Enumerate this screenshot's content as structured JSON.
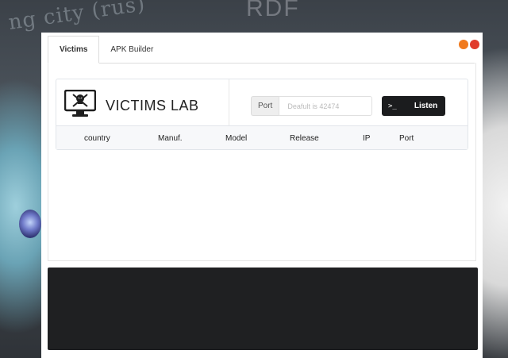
{
  "wallpaper": {
    "text_left": "ng city (rus)",
    "text_right": "RDF"
  },
  "window_controls": {
    "colors": [
      "#f07a1e",
      "#e03b2c"
    ]
  },
  "tabs": [
    {
      "label": "Victims",
      "active": true
    },
    {
      "label": "APK Builder",
      "active": false
    }
  ],
  "panel": {
    "icon": "monitor-skull-icon",
    "title": "VICTIMS LAB"
  },
  "port": {
    "label": "Port",
    "placeholder": "Deafult is 42474",
    "value": ""
  },
  "listen_button": {
    "icon": "terminal-icon",
    "icon_glyph": ">_",
    "label": "Listen"
  },
  "table": {
    "columns": [
      "country",
      "Manuf.",
      "Model",
      "Release",
      "IP",
      "Port"
    ],
    "rows": []
  },
  "colors": {
    "accent_dark": "#1b1c1e",
    "console_bg": "#1f2022"
  }
}
